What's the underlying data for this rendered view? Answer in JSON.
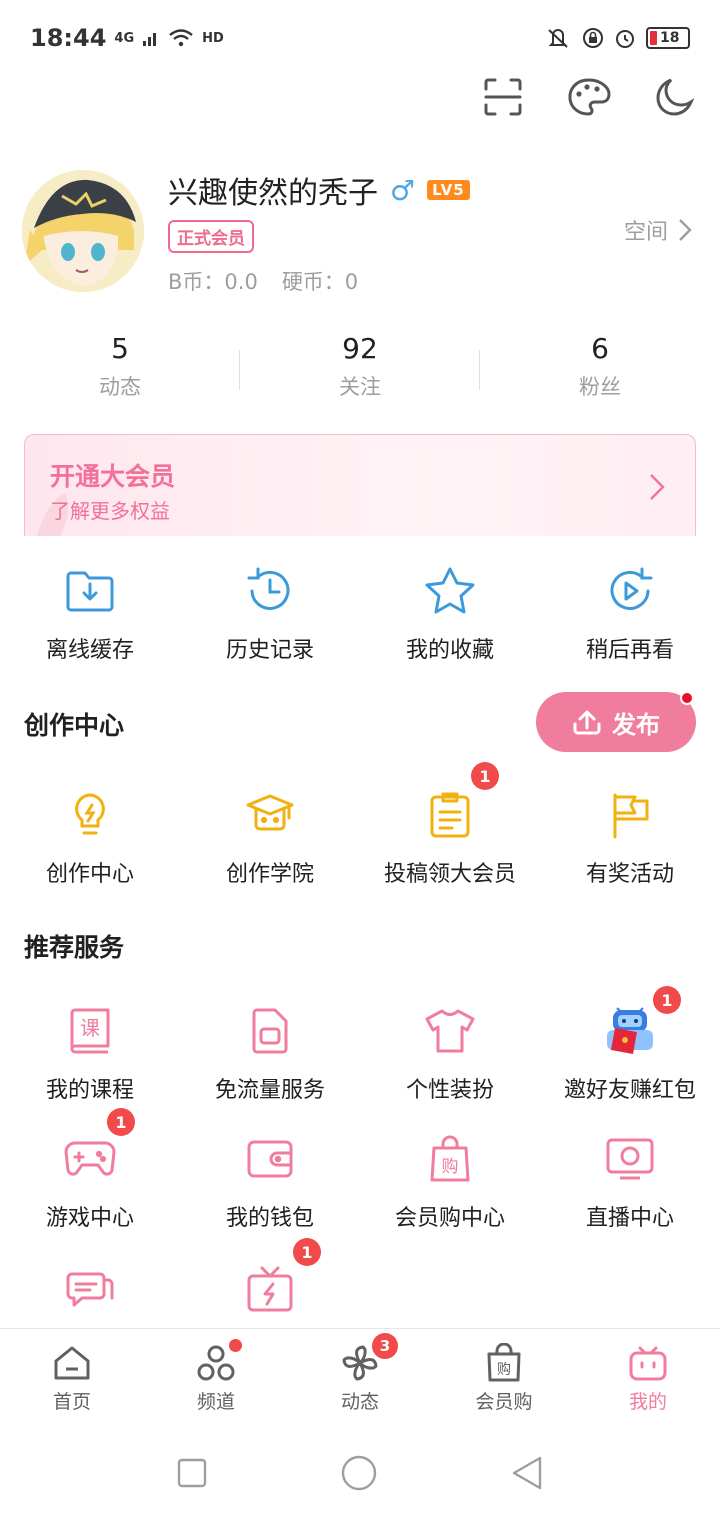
{
  "status": {
    "time": "18:44",
    "net": "4G",
    "hd": "HD",
    "battery": "18"
  },
  "profile": {
    "username": "兴趣使然的秃子",
    "gender_symbol": "♂",
    "level": "LV5",
    "member_badge": "正式会员",
    "bcoin": "B币：0.0",
    "coin": "硬币：0",
    "space_label": "空间"
  },
  "stats": [
    {
      "value": "5",
      "label": "动态"
    },
    {
      "value": "92",
      "label": "关注"
    },
    {
      "value": "6",
      "label": "粉丝"
    }
  ],
  "vip_banner": {
    "title": "开通大会员",
    "subtitle": "了解更多权益"
  },
  "quick_actions": [
    {
      "label": "离线缓存",
      "icon": "download-folder-icon"
    },
    {
      "label": "历史记录",
      "icon": "history-clock-icon"
    },
    {
      "label": "我的收藏",
      "icon": "star-icon"
    },
    {
      "label": "稍后再看",
      "icon": "watch-later-icon"
    }
  ],
  "creation": {
    "title": "创作中心",
    "publish_label": "发布",
    "items": [
      {
        "label": "创作中心",
        "icon": "lightbulb-icon",
        "badge": ""
      },
      {
        "label": "创作学院",
        "icon": "graduation-cap-icon",
        "badge": ""
      },
      {
        "label": "投稿领大会员",
        "icon": "clipboard-icon",
        "badge": "1"
      },
      {
        "label": "有奖活动",
        "icon": "flag-icon",
        "badge": ""
      }
    ]
  },
  "services": {
    "title": "推荐服务",
    "items": [
      {
        "label": "我的课程",
        "icon": "course-book-icon",
        "badge": "",
        "glyph": "课"
      },
      {
        "label": "免流量服务",
        "icon": "sim-card-icon",
        "badge": ""
      },
      {
        "label": "个性装扮",
        "icon": "tshirt-icon",
        "badge": ""
      },
      {
        "label": "邀好友赚红包",
        "icon": "mascot-red-envelope-icon",
        "badge": "1"
      },
      {
        "label": "游戏中心",
        "icon": "gamepad-icon",
        "badge": "1"
      },
      {
        "label": "我的钱包",
        "icon": "wallet-icon",
        "badge": ""
      },
      {
        "label": "会员购中心",
        "icon": "shopping-bag-icon",
        "badge": "",
        "glyph": "购"
      },
      {
        "label": "直播中心",
        "icon": "live-tv-icon",
        "badge": ""
      },
      {
        "label": "",
        "icon": "chat-bubbles-icon",
        "badge": ""
      },
      {
        "label": "",
        "icon": "gift-bolt-icon",
        "badge": "1"
      }
    ]
  },
  "tabs": [
    {
      "label": "首页",
      "icon": "home-icon",
      "badge": "",
      "dot": false
    },
    {
      "label": "频道",
      "icon": "channels-icon",
      "badge": "",
      "dot": true
    },
    {
      "label": "动态",
      "icon": "pinwheel-icon",
      "badge": "3",
      "dot": false
    },
    {
      "label": "会员购",
      "icon": "shop-bag-icon",
      "badge": "",
      "dot": false,
      "glyph": "购"
    },
    {
      "label": "我的",
      "icon": "tv-icon",
      "badge": "",
      "dot": false,
      "active": true
    }
  ],
  "colors": {
    "accent_pink": "#f17d9e",
    "creation_yellow": "#f1b10e",
    "quick_blue": "#3b9ad9",
    "badge_red": "#f04a4a"
  }
}
